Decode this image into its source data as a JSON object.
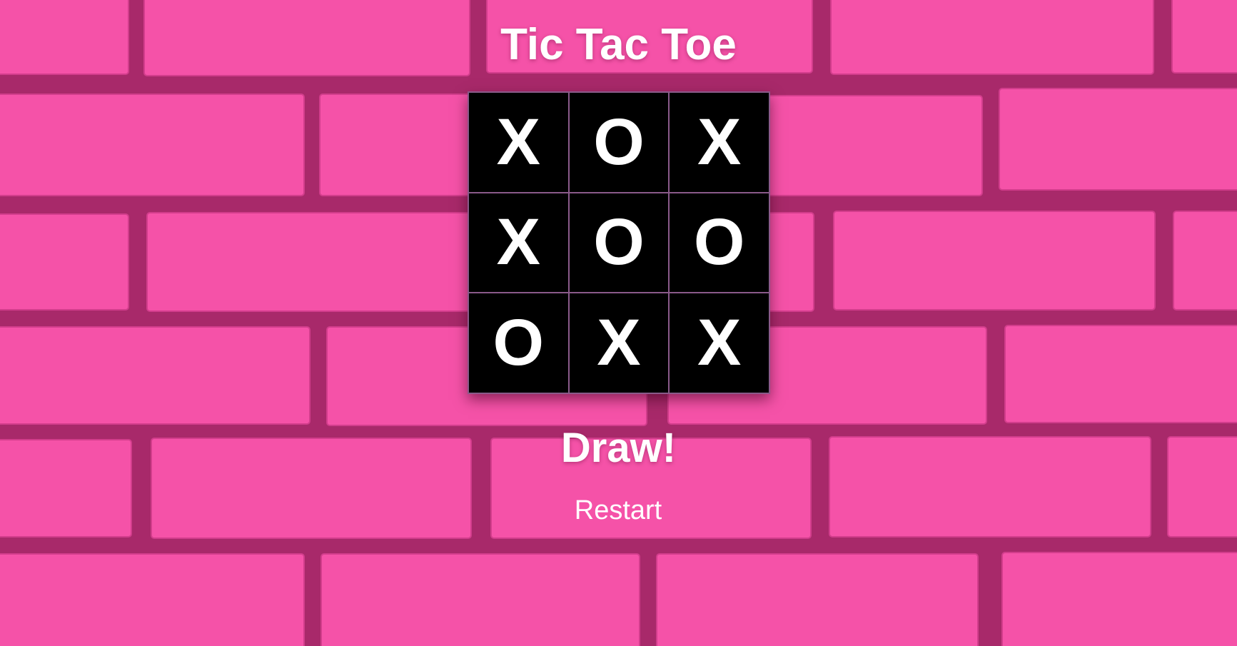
{
  "title": "Tic Tac Toe",
  "board": {
    "cells": [
      "X",
      "O",
      "X",
      "X",
      "O",
      "O",
      "O",
      "X",
      "X"
    ]
  },
  "status": "Draw!",
  "restart_label": "Restart",
  "colors": {
    "background": "#f24fa3",
    "mortar": "#a8296a",
    "board": "#000000",
    "grid_line": "#8a5a8a",
    "text": "#ffffff"
  }
}
